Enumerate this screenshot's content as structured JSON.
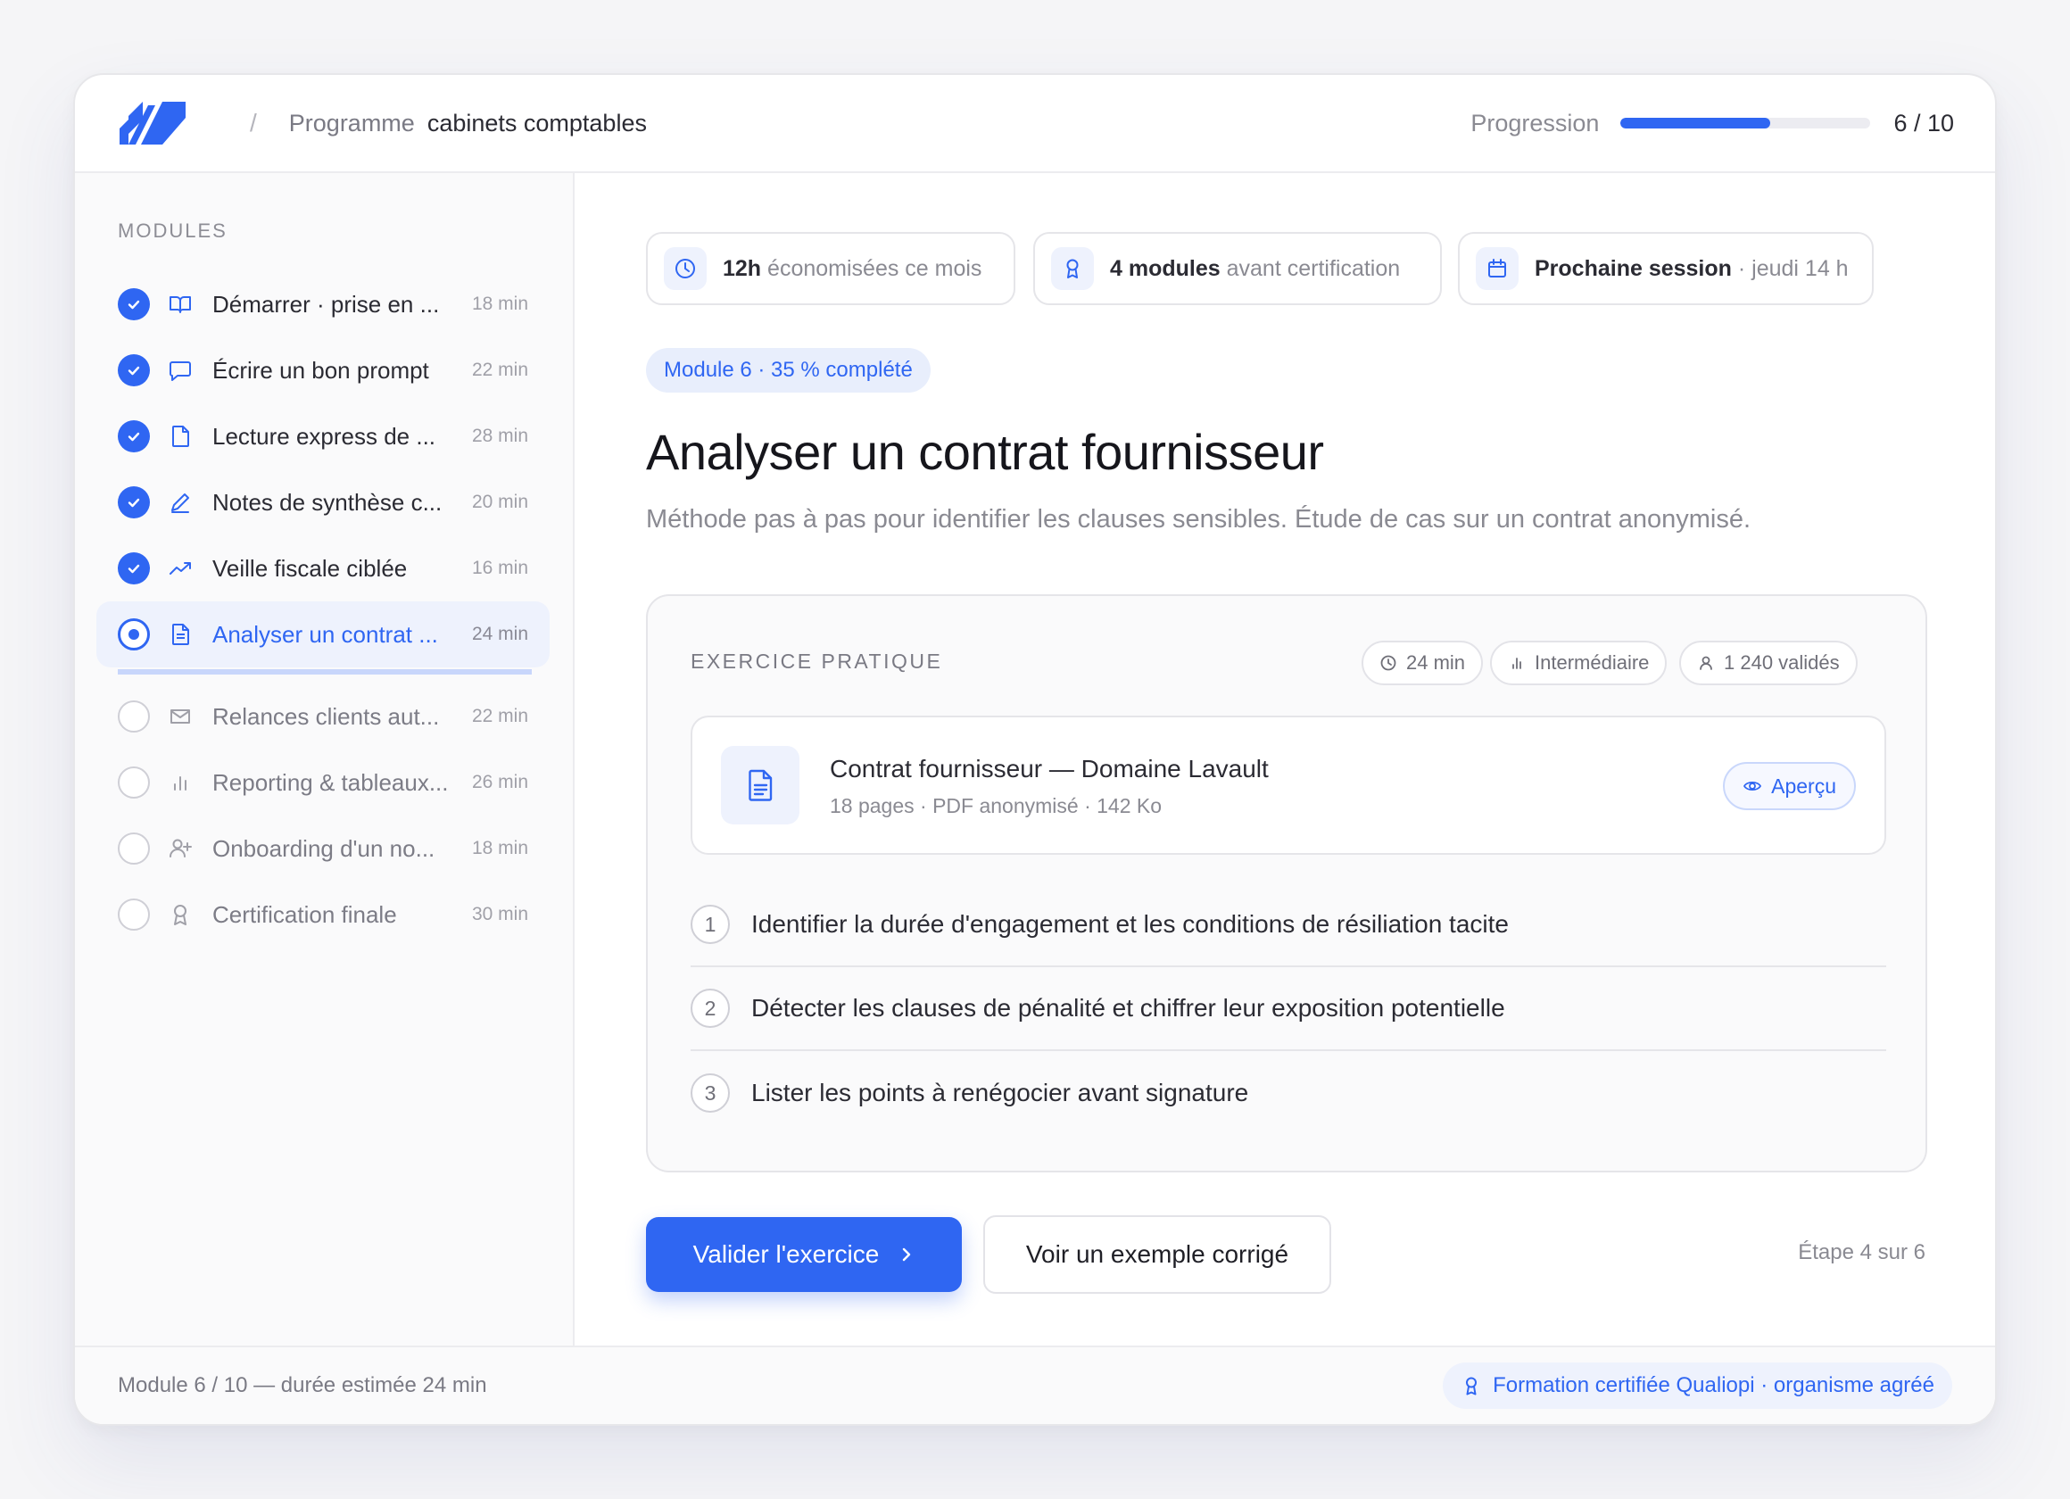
{
  "header": {
    "crumb_sep": "/",
    "crumb_program": "Programme",
    "crumb_current": "cabinets comptables",
    "progress_label": "Progression",
    "progress_fraction": 0.6,
    "progress_count": "6 / 10"
  },
  "sidebar": {
    "title": "MODULES",
    "modules": [
      {
        "label": "Démarrer · prise en ...",
        "time": "18 min",
        "status": "done",
        "icon": "book-icon"
      },
      {
        "label": "Écrire un bon prompt",
        "time": "22 min",
        "status": "done",
        "icon": "chat-icon"
      },
      {
        "label": "Lecture express de ...",
        "time": "28 min",
        "status": "done",
        "icon": "document-icon"
      },
      {
        "label": "Notes de synthèse c...",
        "time": "20 min",
        "status": "done",
        "icon": "pen-icon"
      },
      {
        "label": "Veille fiscale ciblée",
        "time": "16 min",
        "status": "done",
        "icon": "trend-icon"
      },
      {
        "label": "Analyser un contrat ...",
        "time": "24 min",
        "status": "current",
        "icon": "file-text-icon"
      },
      {
        "label": "Relances clients aut...",
        "time": "22 min",
        "status": "todo",
        "icon": "mail-icon"
      },
      {
        "label": "Reporting & tableaux...",
        "time": "26 min",
        "status": "todo",
        "icon": "bar-chart-icon"
      },
      {
        "label": "Onboarding d'un no...",
        "time": "18 min",
        "status": "todo",
        "icon": "user-plus-icon"
      },
      {
        "label": "Certification finale",
        "time": "30 min",
        "status": "todo",
        "icon": "award-icon"
      }
    ]
  },
  "chips": {
    "saved_bold": "12h",
    "saved_rest": "économisées ce mois",
    "cert_bold": "4 modules",
    "cert_rest": "avant certification",
    "session_bold": "Prochaine session",
    "session_rest": "· jeudi 14 h"
  },
  "module": {
    "pill": "Module 6 · 35 % complété",
    "title": "Analyser un contrat fournisseur",
    "subtitle": "Méthode pas à pas pour identifier les clauses sensibles. Étude de cas sur un contrat anonymisé."
  },
  "exercise": {
    "title": "EXERCICE PRATIQUE",
    "tag_time": "24 min",
    "tag_level": "Intermédiaire",
    "tag_validated": "1 240 validés",
    "file_name": "Contrat fournisseur — Domaine Lavault",
    "file_meta": "18 pages · PDF anonymisé · 142 Ko",
    "preview_label": "Aperçu",
    "steps": [
      {
        "num": "1",
        "text": "Identifier la durée d'engagement et les conditions de résiliation tacite"
      },
      {
        "num": "2",
        "text": "Détecter les clauses de pénalité et chiffrer leur exposition potentielle"
      },
      {
        "num": "3",
        "text": "Lister les points à renégocier avant signature"
      }
    ]
  },
  "actions": {
    "validate": "Valider l'exercice",
    "example": "Voir un exemple corrigé",
    "step_counter": "Étape 4 sur 6"
  },
  "footer": {
    "left": "Module 6 / 10 — durée estimée 24 min",
    "badge": "Formation certifiée Qualiopi · organisme agréé"
  },
  "colors": {
    "accent": "#2f66f2",
    "accent_soft": "#eef2fd"
  }
}
